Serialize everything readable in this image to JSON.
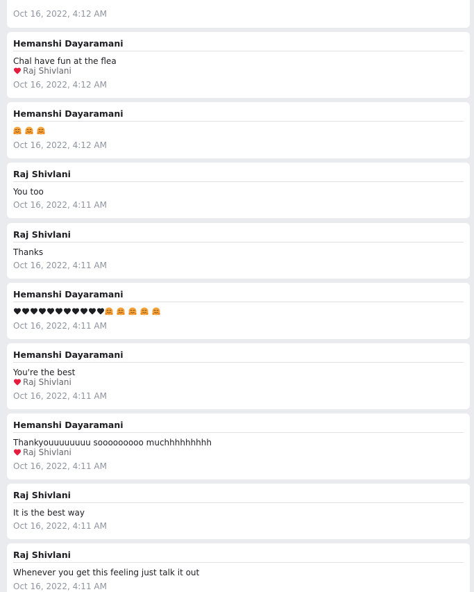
{
  "messages": [
    {
      "sender": "",
      "text": "",
      "reaction": "",
      "time": "Oct 16, 2022, 4:12 AM"
    },
    {
      "sender": "Hemanshi Dayaramani",
      "text": "Chal have fun at the flea",
      "reaction": "Raj Shivlani",
      "time": "Oct 16, 2022, 4:12 AM"
    },
    {
      "sender": "Hemanshi Dayaramani",
      "text": "",
      "emojis": [
        "hugging-face",
        "hugging-face",
        "hugging-face"
      ],
      "reaction": "",
      "time": "Oct 16, 2022, 4:12 AM"
    },
    {
      "sender": "Raj Shivlani",
      "text": "You too",
      "reaction": "",
      "time": "Oct 16, 2022, 4:11 AM"
    },
    {
      "sender": "Raj Shivlani",
      "text": "Thanks",
      "reaction": "",
      "time": "Oct 16, 2022, 4:11 AM"
    },
    {
      "sender": "Hemanshi Dayaramani",
      "text": "",
      "emojis": [
        "black-heart",
        "black-heart",
        "black-heart",
        "black-heart",
        "black-heart",
        "black-heart",
        "black-heart",
        "black-heart",
        "black-heart",
        "black-heart",
        "black-heart",
        "hugging-face",
        "hugging-face",
        "hugging-face",
        "hugging-face",
        "hugging-face"
      ],
      "reaction": "",
      "time": "Oct 16, 2022, 4:11 AM"
    },
    {
      "sender": "Hemanshi Dayaramani",
      "text": "You're the best",
      "reaction": "Raj Shivlani",
      "time": "Oct 16, 2022, 4:11 AM"
    },
    {
      "sender": "Hemanshi Dayaramani",
      "text": "Thankyouuuuuuuu sooooooooo muchhhhhhhhh",
      "reaction": "Raj Shivlani",
      "time": "Oct 16, 2022, 4:11 AM"
    },
    {
      "sender": "Raj Shivlani",
      "text": "It is the best way",
      "reaction": "",
      "time": "Oct 16, 2022, 4:11 AM"
    },
    {
      "sender": "Raj Shivlani",
      "text": "Whenever you get this feeling just talk it out",
      "reaction": "",
      "time": "Oct 16, 2022, 4:11 AM"
    }
  ],
  "colors": {
    "background": "#eaebef",
    "card": "#ffffff",
    "reaction_heart": "#e41e3f",
    "hug_face": "#f7a33a",
    "black_heart": "#1c1e21"
  }
}
